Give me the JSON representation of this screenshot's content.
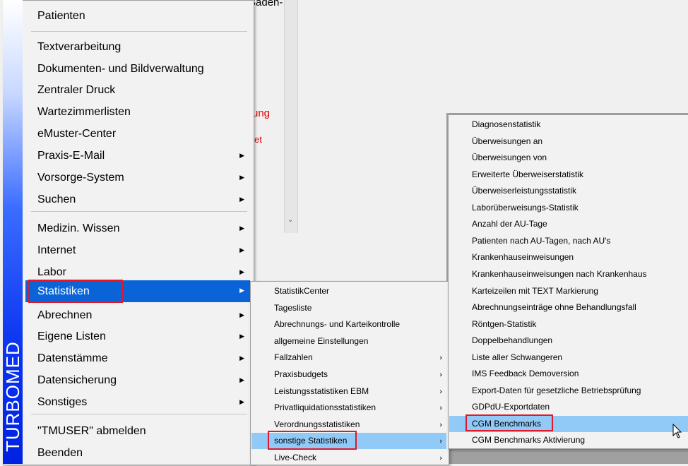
{
  "background": {
    "partial_texts": [
      "Baden-",
      "ung",
      "et"
    ],
    "scroll_arrow_icon": "chevron-down-icon"
  },
  "banner": {
    "text": "TURBOMED"
  },
  "main_menu": {
    "items": [
      {
        "label": "Patienten",
        "submenu": false
      },
      {
        "label": "Textverarbeitung",
        "submenu": false
      },
      {
        "label": "Dokumenten- und Bildverwaltung",
        "submenu": false
      },
      {
        "label": "Zentraler Druck",
        "submenu": false
      },
      {
        "label": "Wartezimmerlisten",
        "submenu": false
      },
      {
        "label": "eMuster-Center",
        "submenu": false
      },
      {
        "label": "Praxis-E-Mail",
        "submenu": true
      },
      {
        "label": "Vorsorge-System",
        "submenu": true
      },
      {
        "label": "Suchen",
        "submenu": true
      },
      {
        "label": "Medizin. Wissen",
        "submenu": true
      },
      {
        "label": "Internet",
        "submenu": true
      },
      {
        "label": "Labor",
        "submenu": true
      },
      {
        "label": "Statistiken",
        "submenu": true,
        "highlighted": true
      },
      {
        "label": "Abrechnen",
        "submenu": true
      },
      {
        "label": "Eigene Listen",
        "submenu": true
      },
      {
        "label": "Datenstämme",
        "submenu": true
      },
      {
        "label": "Datensicherung",
        "submenu": true
      },
      {
        "label": "Sonstiges",
        "submenu": true
      },
      {
        "label": "\"TMUSER\" abmelden",
        "submenu": false
      },
      {
        "label": "Beenden",
        "submenu": false
      }
    ]
  },
  "statistiken_menu": {
    "items": [
      {
        "label": "StatistikCenter",
        "submenu": false
      },
      {
        "label": "Tagesliste",
        "submenu": false
      },
      {
        "label": "Abrechnungs- und Karteikontrolle",
        "submenu": false
      },
      {
        "label": "allgemeine Einstellungen",
        "submenu": false
      },
      {
        "label": "Fallzahlen",
        "submenu": true
      },
      {
        "label": "Praxisbudgets",
        "submenu": true
      },
      {
        "label": "Leistungsstatistiken EBM",
        "submenu": true
      },
      {
        "label": "Privatliquidationsstatistiken",
        "submenu": true
      },
      {
        "label": "Verordnungsstatistiken",
        "submenu": true
      },
      {
        "label": "sonstige Statistiken",
        "submenu": true,
        "highlighted": true
      },
      {
        "label": "Live-Check",
        "submenu": true
      }
    ]
  },
  "sonstige_menu": {
    "items": [
      {
        "label": "Diagnosenstatistik"
      },
      {
        "label": "Überweisungen an"
      },
      {
        "label": "Überweisungen von"
      },
      {
        "label": "Erweiterte Überweiserstatistik"
      },
      {
        "label": "Überweiserleistungsstatistik"
      },
      {
        "label": "Laborüberweisungs-Statistik"
      },
      {
        "label": "Anzahl der AU-Tage"
      },
      {
        "label": "Patienten nach AU-Tagen, nach AU's"
      },
      {
        "label": "Krankenhauseinweisungen"
      },
      {
        "label": "Krankenhauseinweisungen nach Krankenhaus"
      },
      {
        "label": "Karteizeilen mit TEXT Markierung"
      },
      {
        "label": "Abrechnungseinträge ohne Behandlungsfall"
      },
      {
        "label": "Röntgen-Statistik"
      },
      {
        "label": "Doppelbehandlungen"
      },
      {
        "label": "Liste aller Schwangeren"
      },
      {
        "label": "IMS Feedback Demoversion"
      },
      {
        "label": "Export-Daten für gesetzliche Betriebsprüfung"
      },
      {
        "label": "GDPdU-Exportdaten"
      },
      {
        "label": "CGM Benchmarks",
        "highlighted": true
      },
      {
        "label": "CGM Benchmarks Aktivierung"
      }
    ]
  },
  "colors": {
    "highlight_main": "#0a64d8",
    "highlight_sub": "#91c9f7",
    "annotation_box": "#e0182a",
    "banner_blue": "#0022e0"
  }
}
